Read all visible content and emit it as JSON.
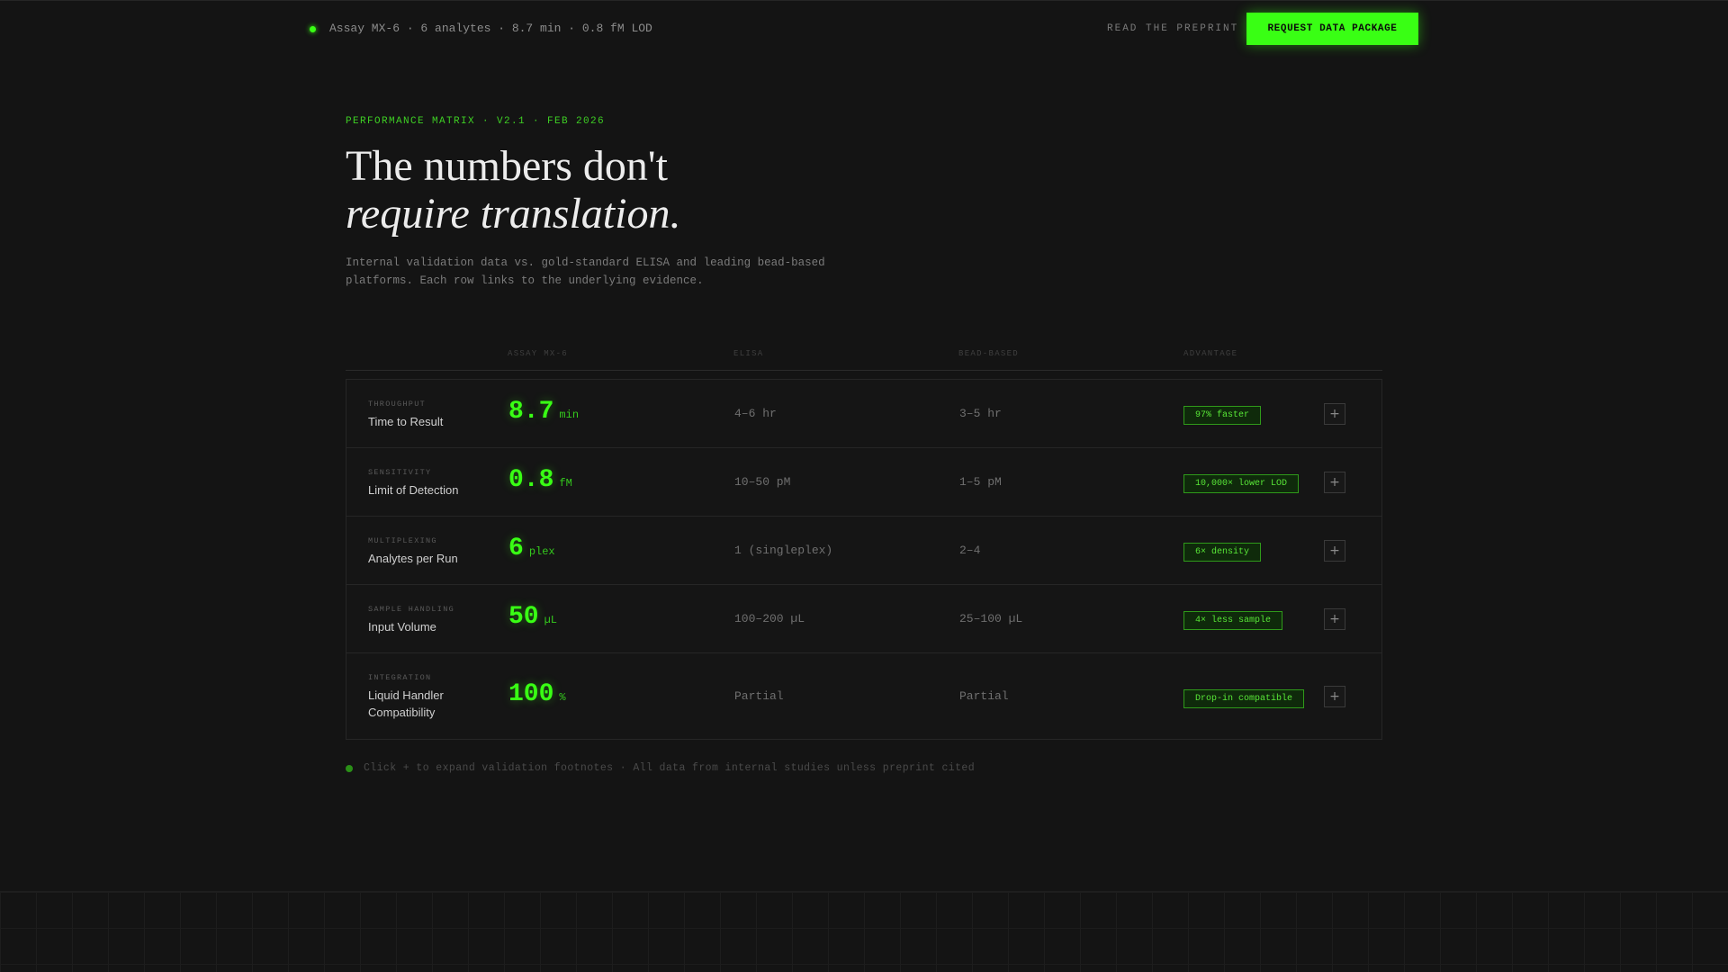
{
  "topbar": {
    "status_text": "Assay MX-6 · 6 analytes · 8.7 min · 0.8 fM LOD",
    "preprint_link": "READ THE PREPRINT",
    "cta_label": "REQUEST DATA PACKAGE"
  },
  "hero": {
    "eyebrow": "PERFORMANCE MATRIX · V2.1 · FEB 2026",
    "headline_line1": "The numbers don't",
    "headline_line2": "require translation.",
    "subcopy": "Internal validation data vs. gold-standard ELISA and leading bead-based platforms. Each row links to the underlying evidence."
  },
  "table": {
    "columns": [
      "ASSAY MX-6",
      "ELISA",
      "BEAD-BASED",
      "ADVANTAGE"
    ],
    "rows": [
      {
        "category": "THROUGHPUT",
        "metric": "Time to Result",
        "value": "8.7",
        "unit": "min",
        "elisa": "4–6 hr",
        "bead": "3–5 hr",
        "advantage": "97% faster",
        "expand": "+"
      },
      {
        "category": "SENSITIVITY",
        "metric": "Limit of Detection",
        "value": "0.8",
        "unit": "fM",
        "elisa": "10–50 pM",
        "bead": "1–5 pM",
        "advantage": "10,000× lower LOD",
        "expand": "+"
      },
      {
        "category": "MULTIPLEXING",
        "metric": "Analytes per Run",
        "value": "6",
        "unit": "plex",
        "elisa": "1 (singleplex)",
        "bead": "2–4",
        "advantage": "6× density",
        "expand": "+"
      },
      {
        "category": "SAMPLE HANDLING",
        "metric": "Input Volume",
        "value": "50",
        "unit": "µL",
        "elisa": "100–200 µL",
        "bead": "25–100 µL",
        "advantage": "4× less sample",
        "expand": "+"
      },
      {
        "category": "INTEGRATION",
        "metric": "Liquid Handler Compatibility",
        "value": "100",
        "unit": "%",
        "elisa": "Partial",
        "bead": "Partial",
        "advantage": "Drop-in compatible",
        "expand": "+"
      }
    ]
  },
  "footnote": "Click + to expand validation footnotes · All data from internal studies unless preprint cited",
  "colors": {
    "accent": "#39ff14",
    "background": "#141414",
    "badge_border": "#2f9a1a"
  }
}
